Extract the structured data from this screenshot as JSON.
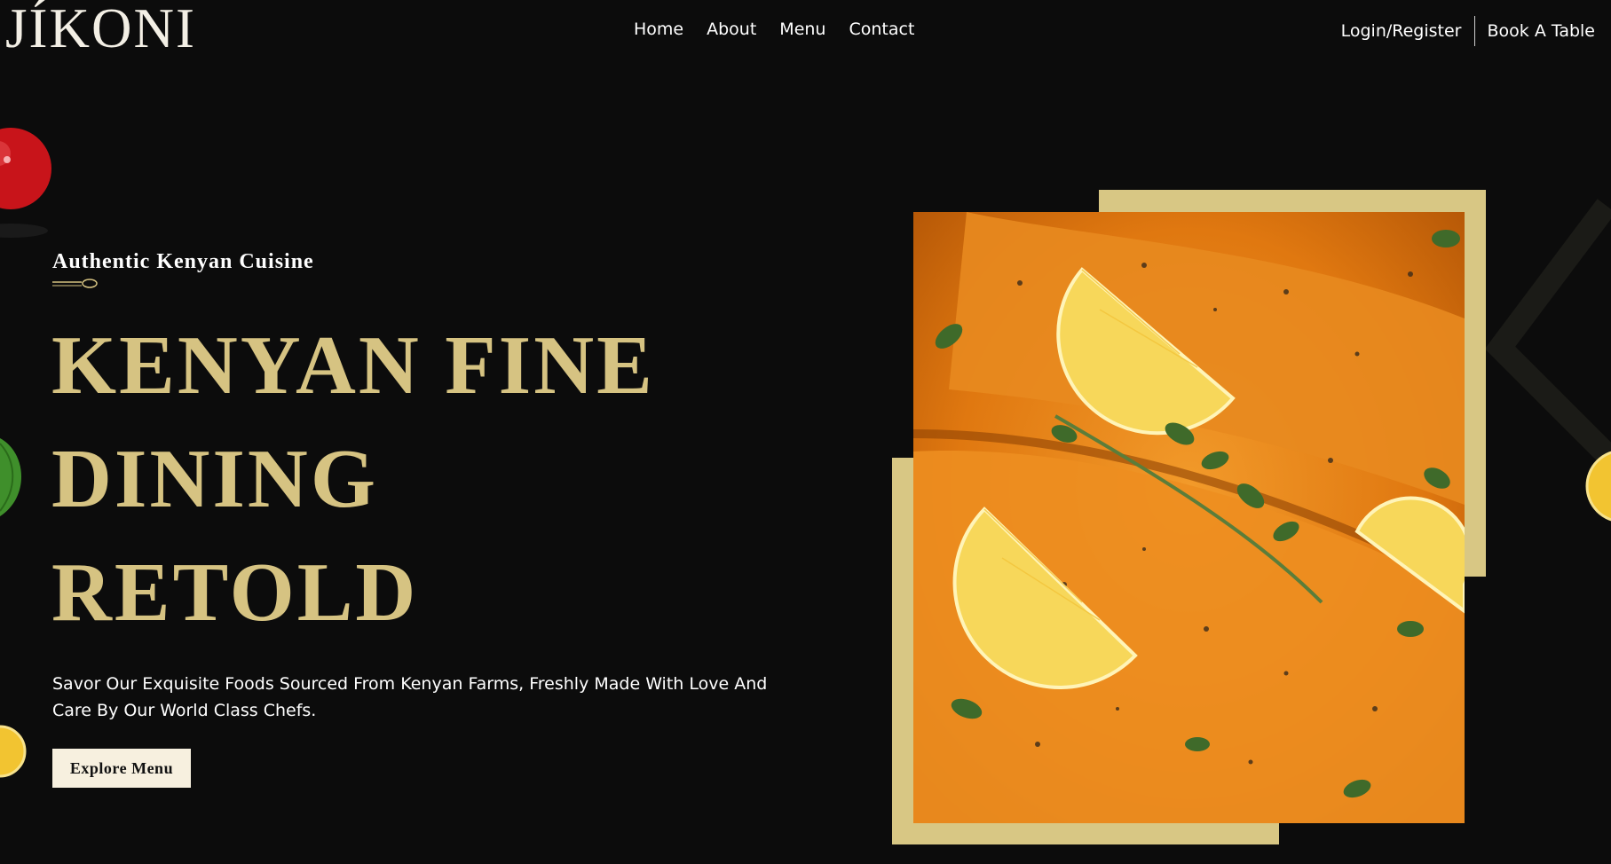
{
  "header": {
    "logo": "JÍKONI",
    "nav": [
      "Home",
      "About",
      "Menu",
      "Contact"
    ],
    "login": "Login/Register",
    "book": "Book A Table"
  },
  "hero": {
    "tagline": "Authentic Kenyan Cuisine",
    "headline": [
      "KENYAN FINE",
      "DINING",
      "RETOLD"
    ],
    "description": "Savor Our Exquisite Foods Sourced From Kenyan Farms, Freshly Made With Love And Care By Our World Class Chefs.",
    "cta": "Explore Menu"
  },
  "colors": {
    "background": "#0c0c0c",
    "accent_gold": "#d6c382",
    "frame": "#d8c784",
    "button_bg": "#f7f0df"
  },
  "icons": [
    "spoon-divider-icon",
    "tomato-decoration",
    "leaf-decoration",
    "lemon-decoration"
  ]
}
